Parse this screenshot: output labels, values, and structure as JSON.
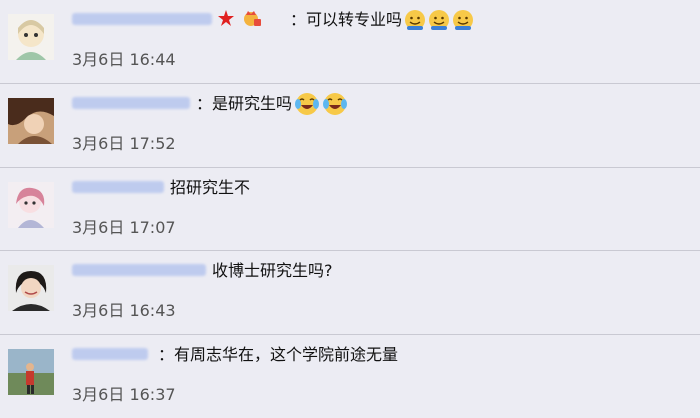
{
  "comments": [
    {
      "text": "：可以转专业吗",
      "time": "3月6日 16:44",
      "emoji_icons": [
        "tongue-smile-icon",
        "tongue-smile-icon",
        "tongue-smile-icon"
      ],
      "badge_icons": [
        "red-star-icon",
        "crown-badge-icon"
      ]
    },
    {
      "text": "：是研究生吗",
      "time": "3月6日 17:52",
      "emoji_icons": [
        "laugh-cry-icon",
        "laugh-cry-icon"
      ]
    },
    {
      "text": "招研究生不",
      "time": "3月6日 17:07",
      "emoji_icons": []
    },
    {
      "text": "收博士研究生吗?",
      "time": "3月6日 16:43",
      "emoji_icons": []
    },
    {
      "text": "：有周志华在，这个学院前途无量",
      "time": "3月6日 16:37",
      "emoji_icons": []
    }
  ],
  "colors": {
    "background": "#ececf3",
    "divider": "#c9c9d2",
    "username_blur": "#b7c6ee",
    "time_text": "#555555"
  }
}
